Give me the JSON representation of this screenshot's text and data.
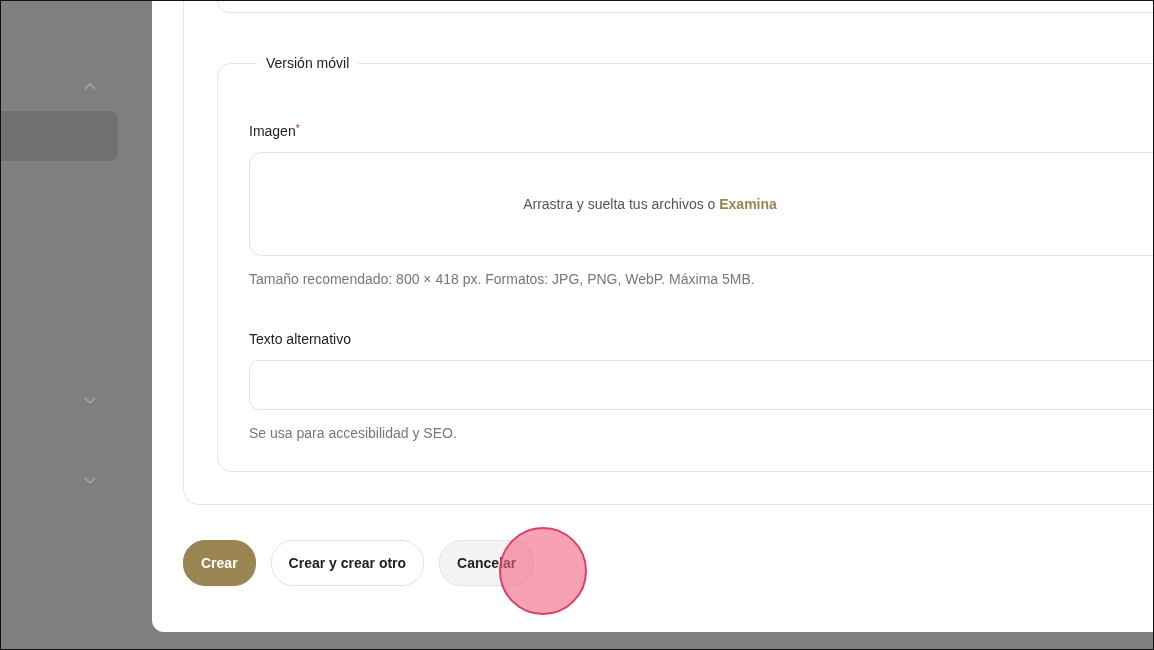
{
  "sidebar": {
    "groups": [
      {
        "expanded": true,
        "items": [
          {
            "selected": true
          }
        ]
      },
      {
        "expanded": false
      },
      {
        "expanded": false
      }
    ]
  },
  "form": {
    "fieldset": {
      "legend": "Versión móvil",
      "fields": [
        {
          "kind": "dropzone",
          "label": "Imagen",
          "required_mark": "*",
          "prompt": "Arrastra y suelta tus archivos o",
          "link": "Examina",
          "help": "Tamaño recomendado: 800 × 418 px. Formatos: JPG, PNG, WebP. Máxima 5MB."
        },
        {
          "kind": "text",
          "label": "Texto alternativo",
          "help": "Se usa para accesibilidad y SEO."
        }
      ]
    }
  },
  "actions": [
    {
      "label": "Crear",
      "kind": "primary",
      "click_indicator": false
    },
    {
      "label": "Crear y crear otro",
      "kind": "outline",
      "click_indicator": false
    },
    {
      "label": "Cancelar",
      "kind": "muted",
      "click_indicator": true
    }
  ]
}
